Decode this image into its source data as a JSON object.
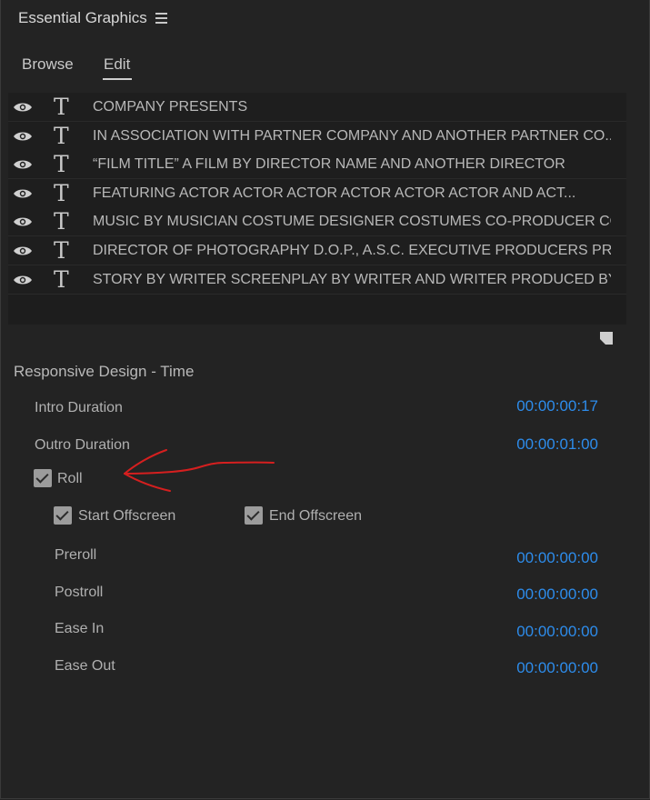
{
  "panel": {
    "title": "Essential Graphics",
    "menu_icon": "hamburger-icon"
  },
  "tabs": [
    {
      "label": "Browse",
      "selected": false
    },
    {
      "label": "Edit",
      "selected": true
    }
  ],
  "layers": [
    {
      "text": "COMPANY PRESENTS"
    },
    {
      "text": "IN ASSOCIATION WITH PARTNER COMPANY AND ANOTHER PARTNER CO..."
    },
    {
      "text": "“FILM TITLE” A FILM BY DIRECTOR NAME AND ANOTHER DIRECTOR"
    },
    {
      "text": "FEATURING ACTOR ACTOR ACTOR ACTOR ACTOR ACTOR AND ACT..."
    },
    {
      "text": "MUSIC BY MUSICIAN COSTUME DESIGNER COSTUMES CO-PRODUCER CO-..."
    },
    {
      "text": "DIRECTOR OF PHOTOGRAPHY D.O.P., A.S.C.  EXECUTIVE PRODUCERS PRO..."
    },
    {
      "text": "STORY BY WRITER SCREENPLAY BY WRITER AND WRITER PRODUCED BY P..."
    }
  ],
  "responsive_design": {
    "title": "Responsive Design - Time",
    "intro": {
      "label": "Intro Duration",
      "value": "00:00:00:17"
    },
    "outro": {
      "label": "Outro Duration",
      "value": "00:00:01:00"
    },
    "roll": {
      "label": "Roll",
      "checked": true
    },
    "start_offscreen": {
      "label": "Start Offscreen",
      "checked": true
    },
    "end_offscreen": {
      "label": "End Offscreen",
      "checked": true
    },
    "preroll": {
      "label": "Preroll",
      "value": "00:00:00:00"
    },
    "postroll": {
      "label": "Postroll",
      "value": "00:00:00:00"
    },
    "ease_in": {
      "label": "Ease In",
      "value": "00:00:00:00"
    },
    "ease_out": {
      "label": "Ease Out",
      "value": "00:00:00:00"
    }
  },
  "colors": {
    "background": "#232323",
    "timecode": "#2d8ceb",
    "annotation": "#d51f1f"
  }
}
